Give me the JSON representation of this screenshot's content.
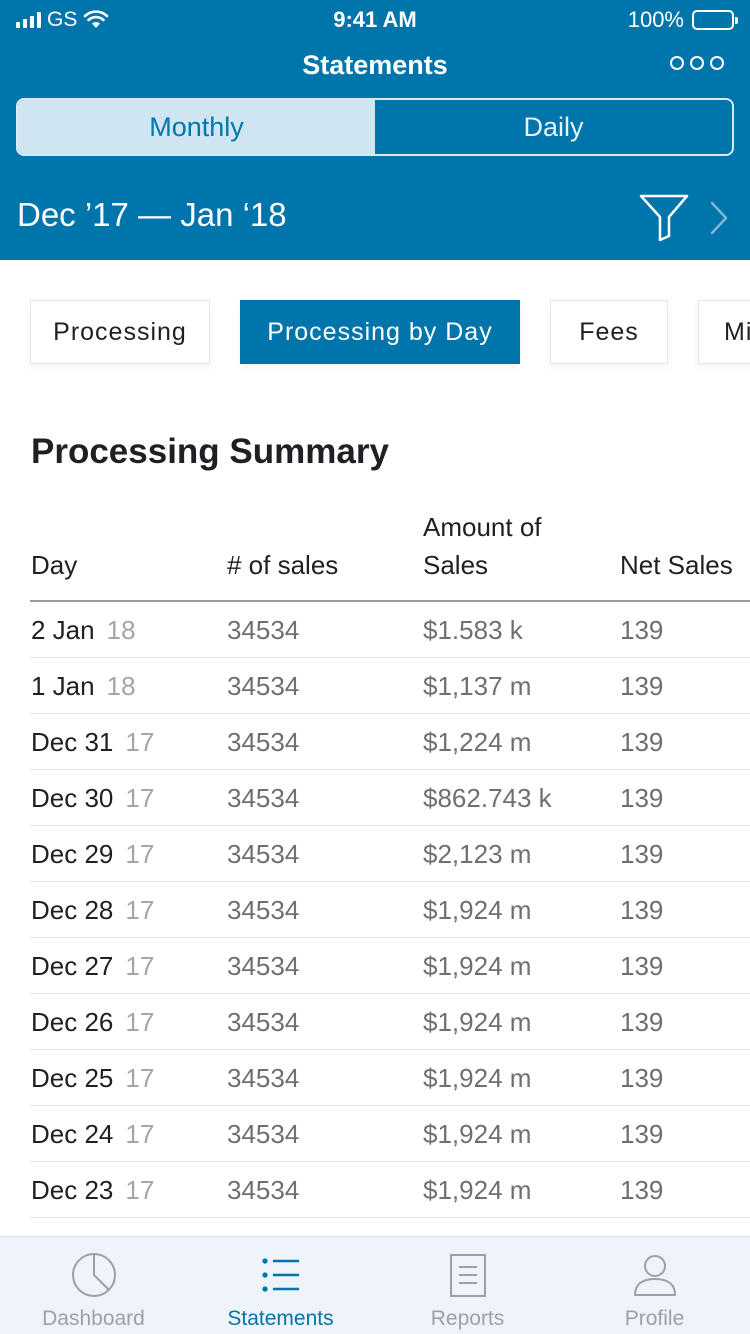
{
  "status_bar": {
    "carrier": "GS",
    "time": "9:41 AM",
    "battery": "100%"
  },
  "header": {
    "title": "Statements",
    "segments": [
      "Monthly",
      "Daily"
    ],
    "selected_segment": "Monthly",
    "date_range": "Dec ’17 — Jan ‘18"
  },
  "category_tabs": [
    "Processing",
    "Processing by Day",
    "Fees",
    "Mi"
  ],
  "selected_category": "Processing by Day",
  "summary": {
    "title": "Processing Summary",
    "columns": [
      "Day",
      "# of sales",
      "Amount of Sales",
      "Net Sales"
    ],
    "rows": [
      {
        "day": "2 Jan",
        "year": "18",
        "sales": "34534",
        "amount": "$1.583 k",
        "net": "139"
      },
      {
        "day": "1 Jan",
        "year": "18",
        "sales": "34534",
        "amount": "$1,137 m",
        "net": "139"
      },
      {
        "day": "Dec 31",
        "year": "17",
        "sales": "34534",
        "amount": "$1,224 m",
        "net": "139"
      },
      {
        "day": "Dec 30",
        "year": "17",
        "sales": "34534",
        "amount": "$862.743 k",
        "net": "139"
      },
      {
        "day": "Dec 29",
        "year": "17",
        "sales": "34534",
        "amount": "$2,123 m",
        "net": "139"
      },
      {
        "day": "Dec 28",
        "year": "17",
        "sales": "34534",
        "amount": "$1,924 m",
        "net": "139"
      },
      {
        "day": "Dec 27",
        "year": "17",
        "sales": "34534",
        "amount": "$1,924 m",
        "net": "139"
      },
      {
        "day": "Dec 26",
        "year": "17",
        "sales": "34534",
        "amount": "$1,924 m",
        "net": "139"
      },
      {
        "day": "Dec 25",
        "year": "17",
        "sales": "34534",
        "amount": "$1,924 m",
        "net": "139"
      },
      {
        "day": "Dec 24",
        "year": "17",
        "sales": "34534",
        "amount": "$1,924 m",
        "net": "139"
      },
      {
        "day": "Dec 23",
        "year": "17",
        "sales": "34534",
        "amount": "$1,924 m",
        "net": "139"
      }
    ]
  },
  "tab_bar": {
    "items": [
      {
        "label": "Dashboard",
        "icon": "pie-chart-icon"
      },
      {
        "label": "Statements",
        "icon": "list-icon"
      },
      {
        "label": "Reports",
        "icon": "document-icon"
      },
      {
        "label": "Profile",
        "icon": "user-icon"
      }
    ],
    "selected": "Statements"
  },
  "colors": {
    "brand": "#0075ab",
    "segment_active_bg": "#cfe5f1",
    "tabbar_bg": "#eef4f9"
  }
}
